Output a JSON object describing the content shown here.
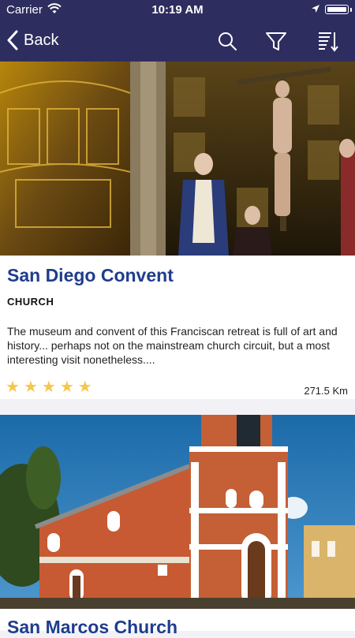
{
  "status_bar": {
    "carrier": "Carrier",
    "time": "10:19 AM"
  },
  "nav": {
    "back_label": "Back",
    "icons": [
      "chevron-left-icon",
      "search-icon",
      "filter-icon",
      "sort-icon"
    ]
  },
  "places": [
    {
      "title": "San Diego Convent",
      "category": "CHURCH",
      "description": "The museum and convent of this Franciscan retreat is full of art and history... perhaps not on the mainstream church circuit, but a most interesting visit nonetheless....",
      "rating": 5,
      "distance": "271.5 Km"
    },
    {
      "title": "San Marcos Church"
    }
  ],
  "colors": {
    "nav_background": "#2e2d5f",
    "title_color": "#1f3d8c",
    "star_color": "#f7c64c"
  }
}
